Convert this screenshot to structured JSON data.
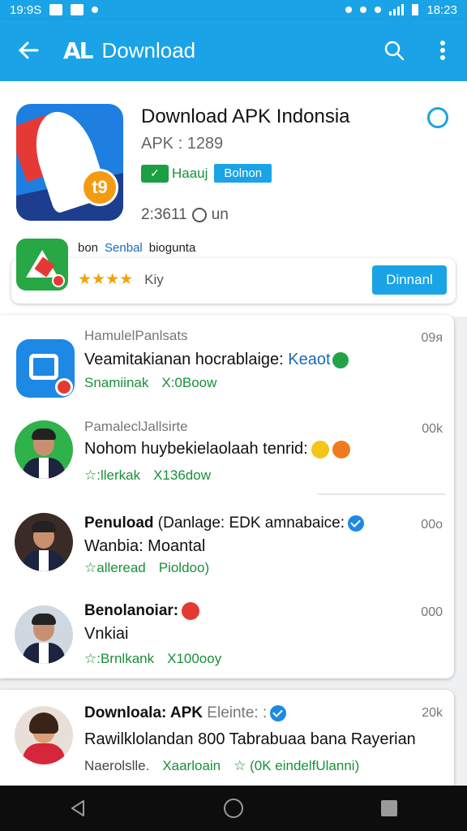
{
  "status_bar": {
    "time_left": "19:9S",
    "time_right": "18:23"
  },
  "app_bar": {
    "logo": "AL",
    "title": "Download"
  },
  "hero": {
    "app_name": "Download APK Indonsia",
    "apk_version": "APK : 1289",
    "badge_icon_text": "t9",
    "chip_green_label": "Haauj",
    "chip_blue_label": "Bolnon",
    "meta_text": "2:3611",
    "meta_unit": "un"
  },
  "sub_card": {
    "line_left": "bon",
    "line_blue": "Senbal",
    "line_right": "bioguntа",
    "stars": "★★★★",
    "rating_label": "Kiy",
    "button_label": "Dinnanl"
  },
  "list": [
    {
      "title": "HamulelPanlsats",
      "subtitle": "Veamitakianan hocrablaige: ",
      "subtitle_accent": "Keaot",
      "foot_left": "Snamiinak",
      "foot_right": "X:0Boow",
      "time": "09я"
    },
    {
      "title": "PamaleclJallsirte",
      "subtitle": "Nohom huybekielaolaah tenrid:",
      "foot_left": "☆:llerkak",
      "foot_right": "X136dow",
      "time": "00k"
    },
    {
      "title": "Penuload",
      "title_rest": " (Danlage: EDK amnabaice:",
      "subtitle": "Wanbia: Moantal",
      "foot_left": "☆alleread",
      "foot_right": "Pioldoo)",
      "time": "00o"
    },
    {
      "title": "Benolanoiar:",
      "subtitle": "Vnkiai",
      "foot_left": "☆:Brnlkank",
      "foot_right": "X100ooy",
      "time": "000"
    }
  ],
  "bottom_item": {
    "title": "Downloala: APK",
    "title_grey": " Eleinte: :",
    "subtitle": "Rawilklolandan 800 Tabrabuaa bana Rayerian",
    "foot_left": "Naerolslle.",
    "foot_mid": "Xaarloain",
    "foot_right": "☆ (0K eindelfUlanni)",
    "time": "20k"
  },
  "colors": {
    "primary": "#1aa3e6",
    "green": "#1a8f3a",
    "star": "#f0a30a"
  }
}
